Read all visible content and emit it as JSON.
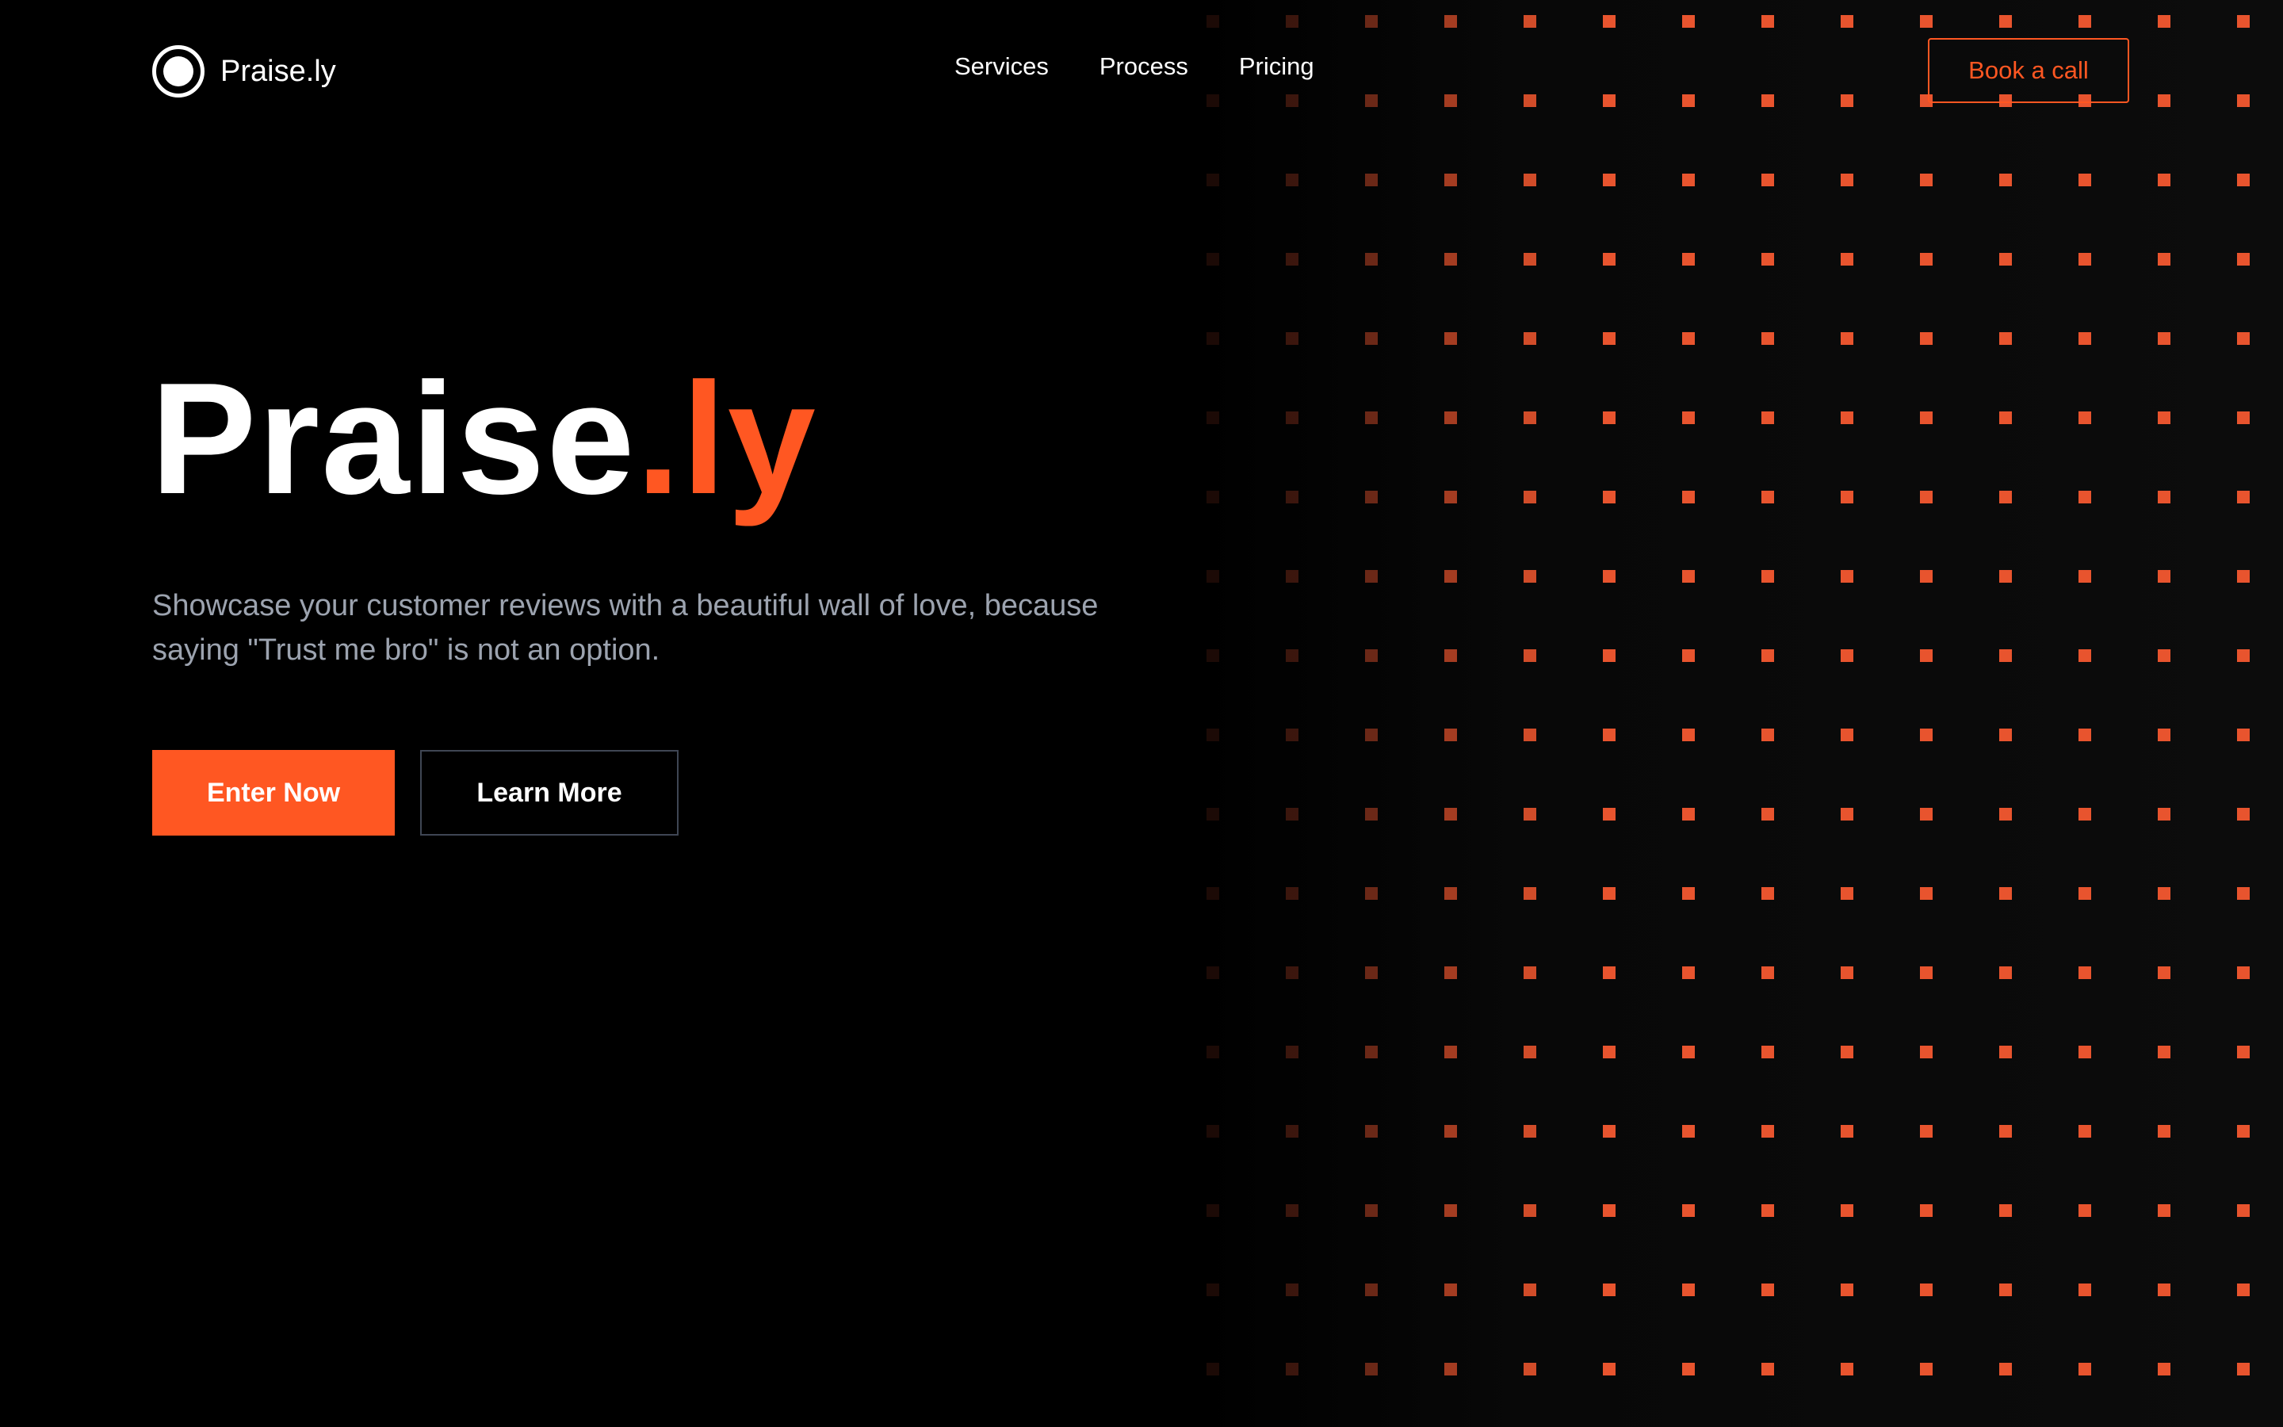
{
  "header": {
    "brand_name": "Praise.ly",
    "logo_icon": "circle-logo-icon",
    "nav": [
      {
        "label": "Services"
      },
      {
        "label": "Process"
      },
      {
        "label": "Pricing"
      }
    ],
    "cta_label": "Book a call"
  },
  "hero": {
    "title_main": "Praise",
    "title_accent": ".ly",
    "subtitle": "Showcase your customer reviews with a beautiful wall of love, because saying \"Trust me bro\" is not an option.",
    "primary_button": "Enter Now",
    "secondary_button": "Learn More"
  },
  "colors": {
    "accent": "#FF5722",
    "background": "#000000",
    "subtitle_text": "#9CA3AF",
    "dot": "#E8542E"
  }
}
